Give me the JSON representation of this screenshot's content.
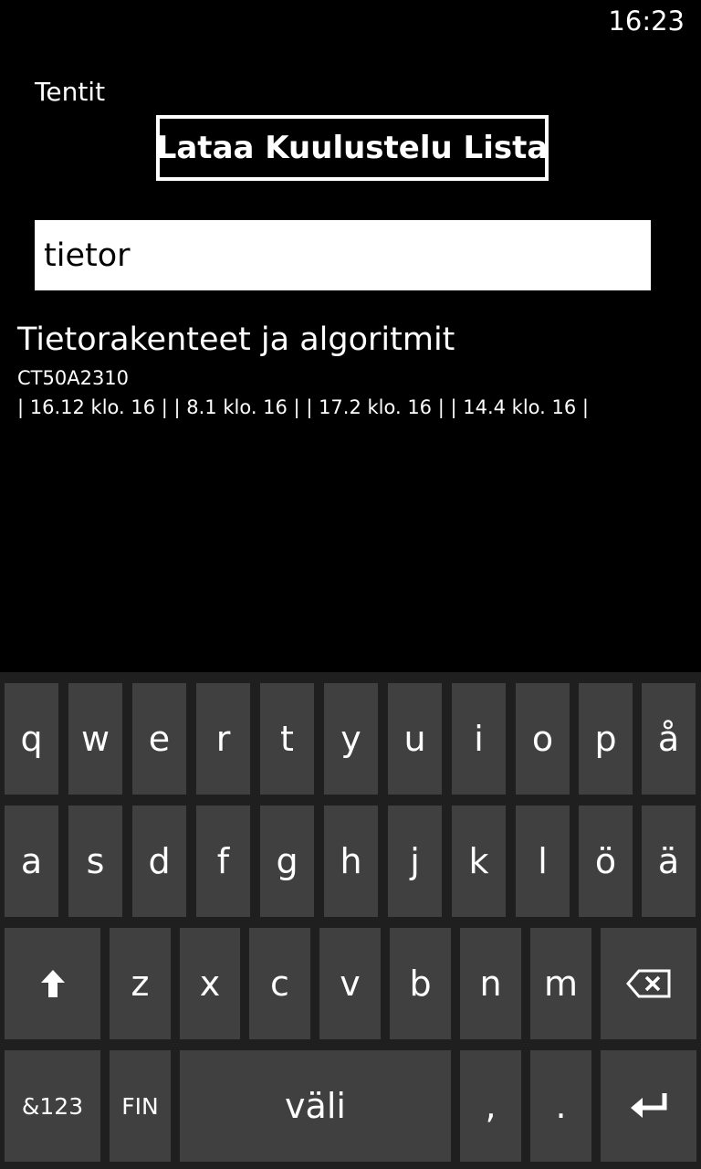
{
  "status_bar": {
    "time": "16:23"
  },
  "app": {
    "title": "Tentit"
  },
  "load_button": {
    "label": "Lataa Kuulustelu Lista"
  },
  "search": {
    "value": "tietor"
  },
  "results": [
    {
      "title": "Tietorakenteet ja algoritmit",
      "code": "CT50A2310",
      "dates": "| 16.12 klo. 16 | | 8.1 klo. 16 | | 17.2 klo. 16 | | 14.4 klo. 16 |"
    }
  ],
  "keyboard": {
    "row1": [
      "q",
      "w",
      "e",
      "r",
      "t",
      "y",
      "u",
      "i",
      "o",
      "p",
      "å"
    ],
    "row2": [
      "a",
      "s",
      "d",
      "f",
      "g",
      "h",
      "j",
      "k",
      "l",
      "ö",
      "ä"
    ],
    "row3": [
      "z",
      "x",
      "c",
      "v",
      "b",
      "n",
      "m"
    ],
    "shift_icon": "shift-arrow-icon",
    "backspace_icon": "backspace-icon",
    "symbols_label": "&123",
    "language_label": "FIN",
    "space_label": "väli",
    "comma_label": ",",
    "period_label": ".",
    "enter_icon": "enter-icon"
  }
}
